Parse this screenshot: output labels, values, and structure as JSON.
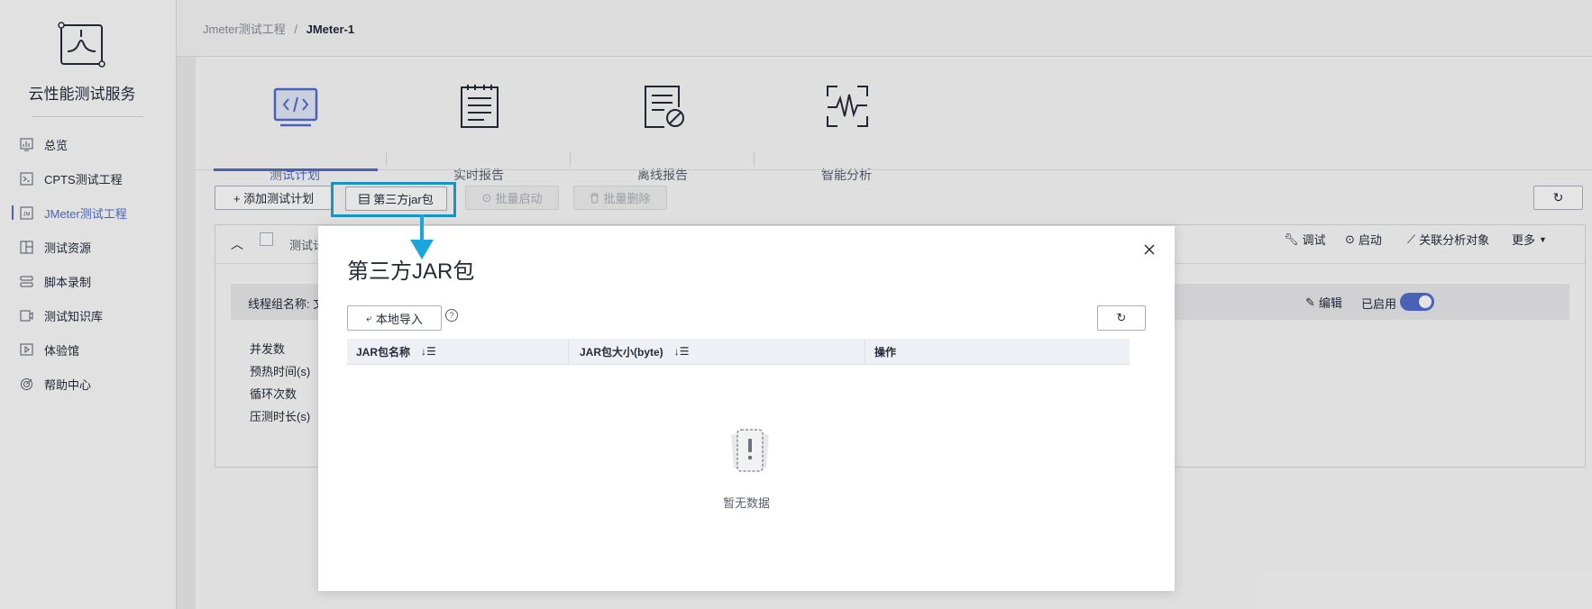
{
  "sidebar": {
    "service_name": "云性能测试服务",
    "items": [
      {
        "label": "总览",
        "icon": "dashboard-icon"
      },
      {
        "label": "CPTS测试工程",
        "icon": "terminal-icon"
      },
      {
        "label": "JMeter测试工程",
        "icon": "jm-icon",
        "active": true
      },
      {
        "label": "测试资源",
        "icon": "resource-icon"
      },
      {
        "label": "脚本录制",
        "icon": "record-icon"
      },
      {
        "label": "测试知识库",
        "icon": "video-icon"
      },
      {
        "label": "体验馆",
        "icon": "play-icon"
      },
      {
        "label": "帮助中心",
        "icon": "target-icon"
      }
    ]
  },
  "breadcrumb": {
    "parent": "Jmeter测试工程",
    "separator": "/",
    "current": "JMeter-1"
  },
  "tabs": [
    {
      "label": "测试计划",
      "icon": "code-monitor-icon",
      "active": true
    },
    {
      "label": "实时报告",
      "icon": "report-list-icon"
    },
    {
      "label": "离线报告",
      "icon": "offline-report-icon"
    },
    {
      "label": "智能分析",
      "icon": "waveform-icon"
    }
  ],
  "toolbar": {
    "add_plan": "+ 添加测试计划",
    "third_party_jar": "第三方jar包",
    "batch_start": "批量启动",
    "batch_delete": "批量删除"
  },
  "plan_row": {
    "name": "测试计",
    "debug": "调试",
    "start": "启动",
    "link_analysis": "关联分析对象",
    "more": "更多"
  },
  "thread_group": {
    "name_label": "线程组名称: 文",
    "edit": "编辑",
    "enabled_label": "已启用",
    "params": [
      "并发数",
      "预热时间(s)",
      "循环次数",
      "压测时长(s)"
    ]
  },
  "dialog": {
    "title": "第三方JAR包",
    "import_button": "本地导入",
    "columns": [
      "JAR包名称",
      "JAR包大小(byte)",
      "操作"
    ],
    "empty_text": "暂无数据"
  },
  "colors": {
    "primary": "#526ecc",
    "highlight": "#1aa5dc"
  }
}
